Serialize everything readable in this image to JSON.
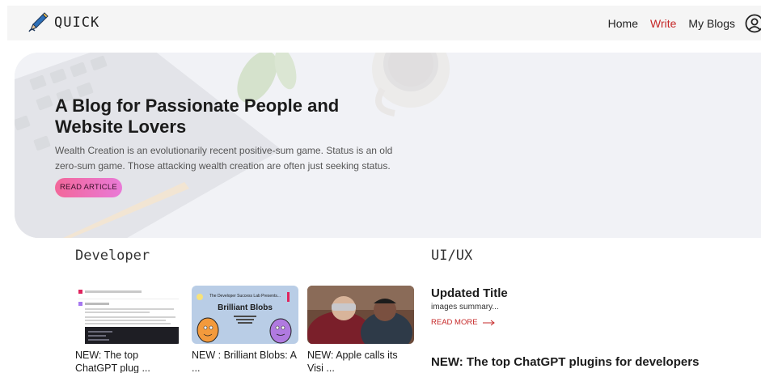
{
  "brand": {
    "name": "QUICK",
    "icon": "pen-icon"
  },
  "nav": {
    "links": [
      {
        "label": "Home",
        "active": false
      },
      {
        "label": "Write",
        "active": true
      },
      {
        "label": "My Blogs",
        "active": false
      }
    ],
    "user_icon": "user-circle-icon"
  },
  "hero": {
    "title": "A Blog for Passionate People and Website Lovers",
    "description": "Wealth Creation is an evolutionarily recent positive-sum game. Status is an old zero-sum game. Those attacking wealth creation are often just seeking status.",
    "button_label": "READ ARTICLE"
  },
  "sections": {
    "developer": {
      "title": "Developer",
      "cards": [
        {
          "title": "NEW: The top ChatGPT plug ...",
          "thumb": "chatgpt-screenshot"
        },
        {
          "title": "NEW : Brilliant Blobs: A ...",
          "thumb": "brilliant-blobs-illustration",
          "thumb_heading": "The Developer Success Lab Presents...",
          "thumb_title": "Brilliant Blobs"
        },
        {
          "title": "NEW: Apple calls its Visi ...",
          "thumb": "vision-pro-photo"
        }
      ]
    },
    "uiux": {
      "title": "UI/UX",
      "posts": [
        {
          "title": "Updated Title",
          "summary": "images summary...",
          "read_more": "READ MORE"
        },
        {
          "title": "NEW: The top ChatGPT plugins for developers"
        }
      ]
    }
  },
  "colors": {
    "accent": "#c62828",
    "nav_bg": "#f5f5f5",
    "button_gradient_start": "#f2679a",
    "button_gradient_end": "#e97ad7"
  }
}
